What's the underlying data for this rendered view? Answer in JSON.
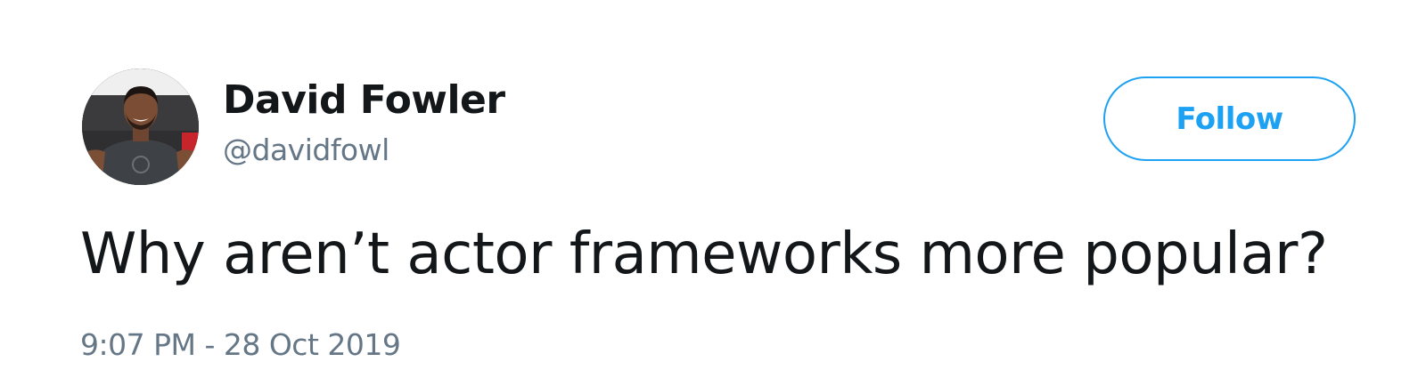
{
  "author": {
    "display_name": "David Fowler",
    "handle": "@davidfowl"
  },
  "follow_button": {
    "label": "Follow"
  },
  "tweet": {
    "text": "Why aren’t actor frameworks more popular?",
    "timestamp": "9:07 PM - 28 Oct 2019"
  },
  "colors": {
    "accent": "#1da1f2",
    "text_primary": "#14171a",
    "text_secondary": "#657786"
  },
  "icons": {
    "avatar": "profile-photo"
  }
}
